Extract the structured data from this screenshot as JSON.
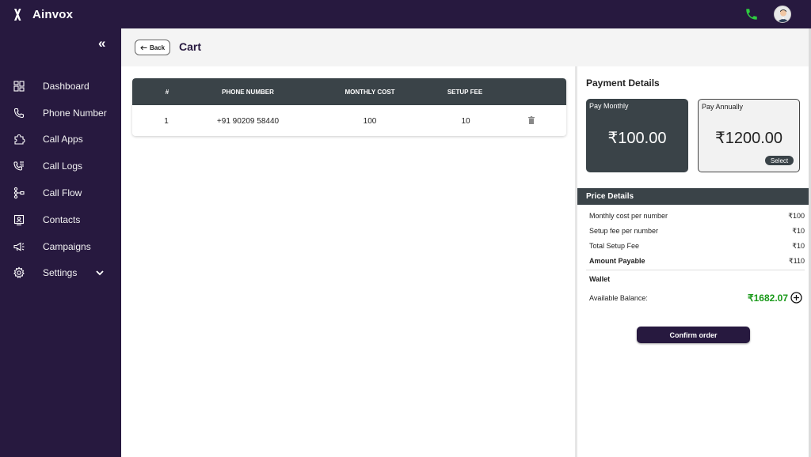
{
  "app": {
    "name": "Ainvox"
  },
  "sidebar": {
    "items": [
      {
        "label": "Dashboard",
        "icon": "dashboard-icon"
      },
      {
        "label": "Phone Number",
        "icon": "phone-icon"
      },
      {
        "label": "Call Apps",
        "icon": "puzzle-icon"
      },
      {
        "label": "Call Logs",
        "icon": "call-logs-icon"
      },
      {
        "label": "Call Flow",
        "icon": "flow-icon"
      },
      {
        "label": "Contacts",
        "icon": "contacts-icon"
      },
      {
        "label": "Campaigns",
        "icon": "megaphone-icon"
      },
      {
        "label": "Settings",
        "icon": "gear-icon"
      }
    ]
  },
  "header": {
    "back_label": "Back",
    "title": "Cart"
  },
  "cart_table": {
    "columns": [
      "#",
      "PHONE NUMBER",
      "MONTHLY COST",
      "SETUP FEE"
    ],
    "rows": [
      {
        "index": "1",
        "phone": "+91 90209 58440",
        "monthly_cost": "100",
        "setup_fee": "10"
      }
    ]
  },
  "payment": {
    "title": "Payment Details",
    "monthly": {
      "label": "Pay Monthly",
      "price": "₹100.00"
    },
    "annual": {
      "label": "Pay Annually",
      "price": "₹1200.00",
      "select_label": "Select"
    }
  },
  "price_details": {
    "title": "Price Details",
    "rows": [
      {
        "label": "Monthly cost per number",
        "value": "₹100"
      },
      {
        "label": "Setup fee per number",
        "value": "₹10"
      },
      {
        "label": "Total Setup Fee",
        "value": "₹10"
      },
      {
        "label": "Amount Payable",
        "value": "₹110"
      }
    ],
    "wallet_label": "Wallet",
    "balance_label": "Available Balance:",
    "balance_value": "₹1682.07"
  },
  "confirm_label": "Confirm order",
  "colors": {
    "sidebar_bg": "#27193f",
    "table_header_bg": "#3a4348",
    "balance_green": "#1a9a1a",
    "phone_green": "#2ecc40"
  }
}
